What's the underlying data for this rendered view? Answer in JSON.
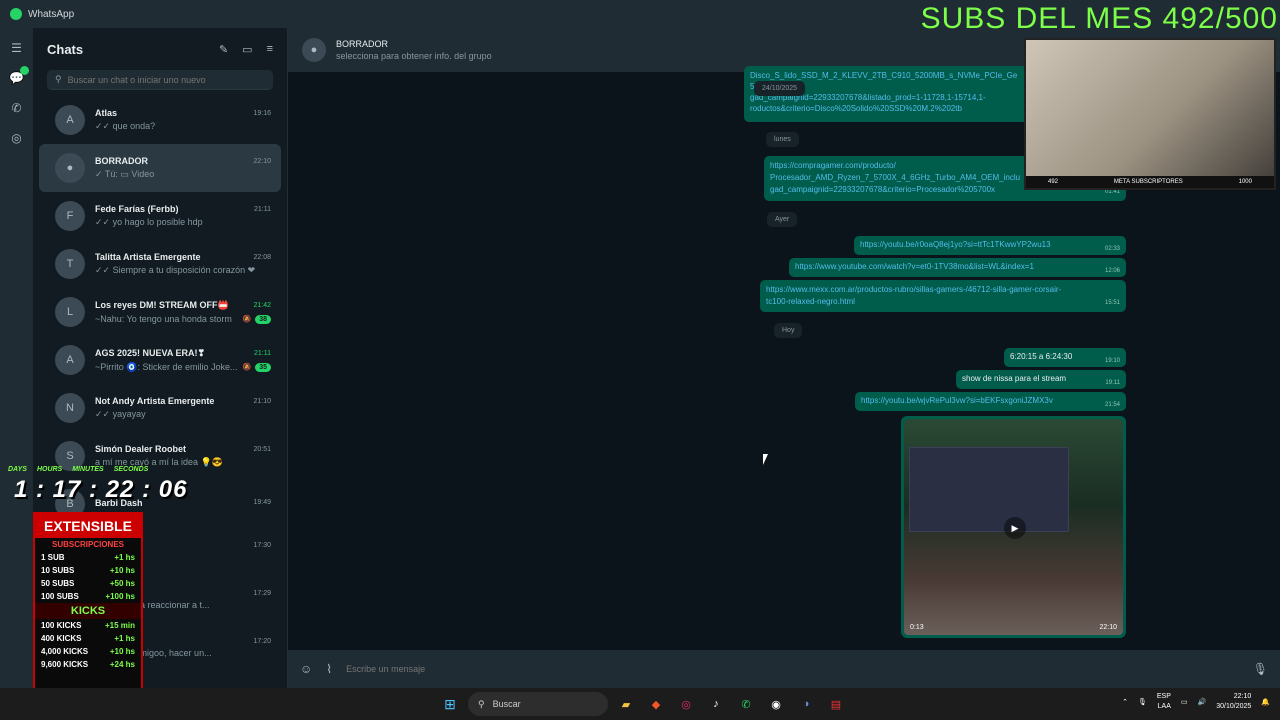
{
  "window": {
    "title": "WhatsApp"
  },
  "overlay": {
    "title": "SUBS DEL MES 492/500",
    "cam_left": "492",
    "cam_center": "META SUBSCRIPTORES",
    "cam_right": "1000",
    "timer_days": "DAYS",
    "timer_hours": "HOURS",
    "timer_minutes": "MINUTES",
    "timer_seconds": "SECONDS",
    "timer_value": "1 : 17 : 22 : 06",
    "promo_title": "EXTENSIBLE",
    "promo_subs_header": "SUBSCRIPCIONES",
    "promo_subs": [
      {
        "label": "1 SUB",
        "value": "+1 hs"
      },
      {
        "label": "10 SUBS",
        "value": "+10 hs"
      },
      {
        "label": "50 SUBS",
        "value": "+50 hs"
      },
      {
        "label": "100 SUBS",
        "value": "+100 hs"
      }
    ],
    "promo_kicks_header": "KICKS",
    "promo_kicks": [
      {
        "label": "100 KICKS",
        "value": "+15 min"
      },
      {
        "label": "400 KICKS",
        "value": "+1 hs"
      },
      {
        "label": "4,000 KICKS",
        "value": "+10 hs"
      },
      {
        "label": "9,600 KICKS",
        "value": "+24 hs"
      }
    ],
    "big_number": "17"
  },
  "sidebar": {
    "title": "Chats",
    "search_placeholder": "Buscar un chat o iniciar uno nuevo",
    "chats": [
      {
        "name": "Atlas",
        "time": "19:16",
        "preview": "✓✓ que onda?",
        "avatar": "A"
      },
      {
        "name": "BORRADOR",
        "time": "22:10",
        "preview": "✓ Tú: ▭ Video",
        "avatar": "●"
      },
      {
        "name": "Fede Farías (Ferbb)",
        "time": "21:11",
        "preview": "✓✓ yo hago lo posible hdp",
        "avatar": "F"
      },
      {
        "name": "Talitta Artista Emergente",
        "time": "22:08",
        "preview": "✓✓ Siempre a tu disposición corazón ❤",
        "avatar": "T"
      },
      {
        "name": "Los reyes DM! STREAM OFF📛",
        "time": "21:42",
        "preview": "~Nahu: Yo tengo una honda storm",
        "unread": "38",
        "avatar": "L"
      },
      {
        "name": "AGS 2025! NUEVA ERA!❣",
        "time": "21:11",
        "preview": "~Pirrito 🧿: Sticker de emilio Joke...",
        "unread": "35",
        "avatar": "A"
      },
      {
        "name": "Not Andy Artista Emergente",
        "time": "21:10",
        "preview": "✓✓ yayayay",
        "avatar": "N"
      },
      {
        "name": "Simón Dealer Roobet",
        "time": "20:51",
        "preview": "a mí me cayó a mí la idea 💡😎",
        "avatar": "S"
      },
      {
        "name": "Barbi Dash",
        "time": "19:49",
        "preview": "",
        "avatar": "B"
      },
      {
        "name": "",
        "time": "17:30",
        "preview": "xplico",
        "avatar": ""
      },
      {
        "name": "",
        "time": "17:29",
        "preview": "y coscu va a reaccionar a t...",
        "avatar": ""
      },
      {
        "name": "",
        "time": "17:20",
        "preview": "juntarnos amigoo, hacer un...",
        "avatar": ""
      }
    ]
  },
  "chat": {
    "name": "BORRADOR",
    "subtitle": "selecciona para obtener info. del grupo",
    "composer_placeholder": "Escribe un mensaje",
    "messages": {
      "m1_line1": "Disco_S_lido_SSD_M_2_KLEVV_2TB_C910_5200MB_s_NVMe_PCIe_Ge",
      "m1_line2": "5",
      "m1_date": "24/10/2025",
      "m1_line3": "gad_campaignid=22933207678&listado_prod=1-11728,1-15714,1-",
      "m1_line4": "roductos&criterio=Disco%20Solido%20SSD%20M.2%202tb",
      "day1": "lunes",
      "m2_line1": "https://compragamer.com/producto/",
      "m2_line2": "Procesador_AMD_Ryzen_7_5700X_4_6GHz_Turbo_AM4_OEM_inclu",
      "m2_line3": "gad_campaignid=22933207678&criterio=Procesador%205700x",
      "m2_time": "01:41",
      "day2": "Ayer",
      "m3": "https://youtu.be/r0oaQ8ej1yo?si=ttTc1TKwwYP2wu13",
      "m3_time": "02:33",
      "m4": "https://www.youtube.com/watch?v=et0-1TV38mo&list=WL&index=1",
      "m4_time": "12:06",
      "m5_line1": "https://www.mexx.com.ar/productos-rubro/sillas-gamers-/46712-silla-gamer-corsair-",
      "m5_line2": "tc100-relaxed-negro.html",
      "m5_time": "15:51",
      "day3": "Hoy",
      "m6": "6:20:15 a 6:24:30",
      "m6_time": "19:10",
      "m7": "show de nissa para el stream",
      "m7_time": "19:11",
      "m8": "https://youtu.be/wjvRePul3vw?si=bEKFsxgoniJZMX3v",
      "m8_time": "21:54",
      "video_duration": "0:13",
      "video_time": "22:10"
    }
  },
  "taskbar": {
    "search_label": "Buscar",
    "lang_top": "ESP",
    "lang_bottom": "LAA",
    "time": "22:10",
    "date": "30/10/2025"
  },
  "colors": {
    "accent": "#25d366",
    "bubble_out": "#005c4b",
    "overlay_green": "#7dff4a"
  }
}
